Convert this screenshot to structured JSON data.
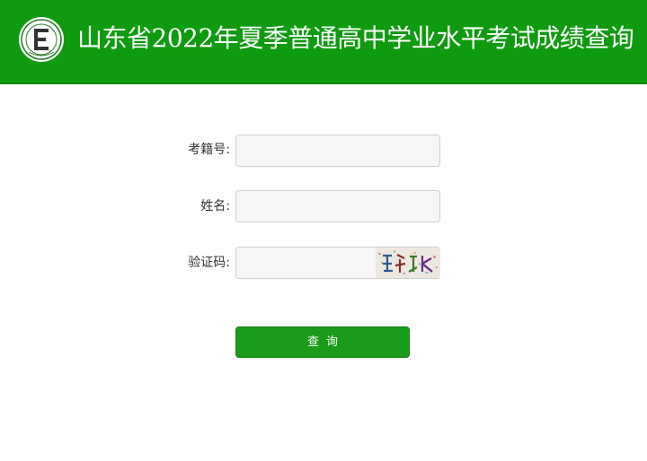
{
  "header": {
    "title": "山东省2022年夏季普通高中学业水平考试成绩查询",
    "logo_icon": "school-emblem-icon",
    "background_color": "#0f9b0f"
  },
  "form": {
    "exam_number": {
      "label": "考籍号:",
      "value": "",
      "placeholder": ""
    },
    "name": {
      "label": "姓名:",
      "value": "",
      "placeholder": ""
    },
    "captcha": {
      "label": "验证码:",
      "value": "",
      "placeholder": "",
      "image_icon": "captcha-image"
    },
    "submit_label": "查询",
    "button_color": "#1a9b1a"
  }
}
